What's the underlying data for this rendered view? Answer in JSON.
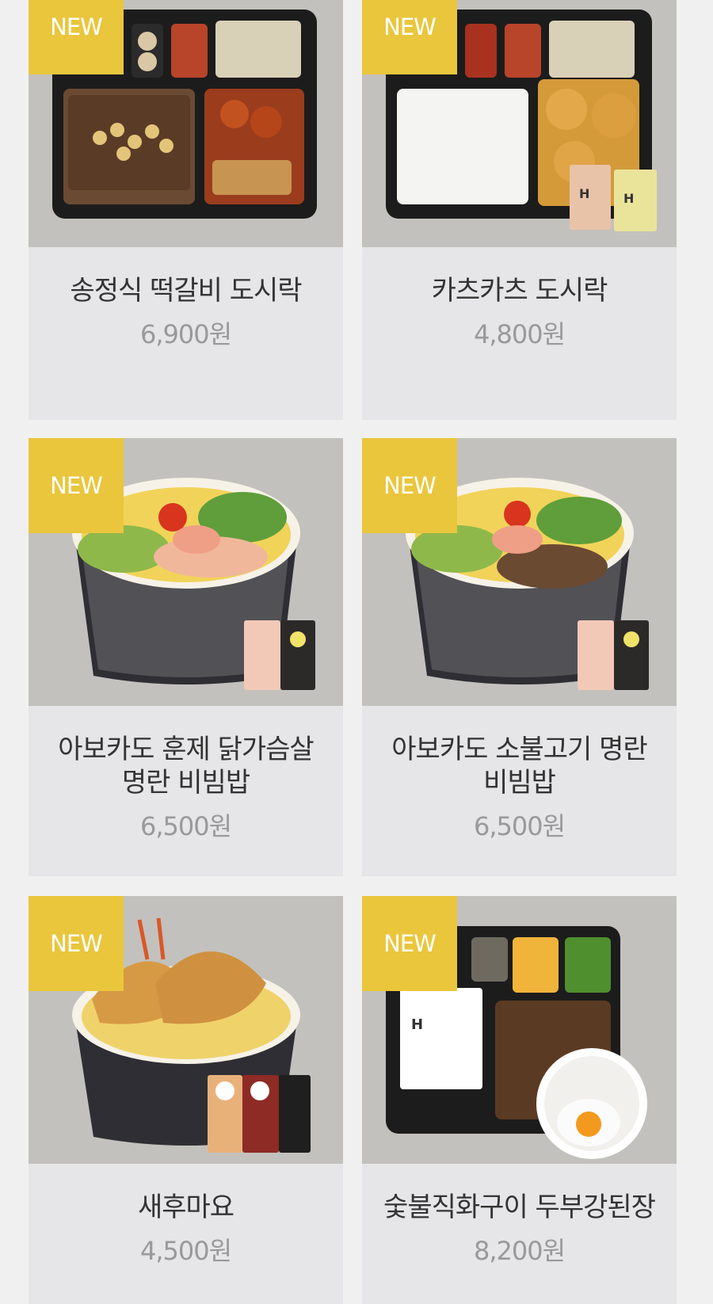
{
  "products": [
    {
      "badge": "NEW",
      "name": "송정식 떡갈비 도시락",
      "price": "6,900원",
      "image": "tteokgalbi-lunchbox-image"
    },
    {
      "badge": "NEW",
      "name": "카츠카츠 도시락",
      "price": "4,800원",
      "image": "katsu-lunchbox-image"
    },
    {
      "badge": "NEW",
      "name": "아보카도 훈제 닭가슴살 명란 비빔밥",
      "price": "6,500원",
      "image": "avocado-chicken-bibimbap-image"
    },
    {
      "badge": "NEW",
      "name": "아보카도 소불고기 명란 비빔밥",
      "price": "6,500원",
      "image": "avocado-bulgogi-bibimbap-image"
    },
    {
      "badge": "NEW",
      "name": "새후마요",
      "price": "4,500원",
      "image": "shrimp-mayo-bowl-image"
    },
    {
      "badge": "NEW",
      "name": "숯불직화구이 두부강된장",
      "price": "8,200원",
      "image": "charcoal-tofu-doenjang-image"
    }
  ],
  "colors": {
    "badge": "#e9c63c",
    "card_bg": "#e6e5e7",
    "image_bg": "#c3c1bd",
    "name_text": "#333333",
    "price_text": "#999999"
  }
}
